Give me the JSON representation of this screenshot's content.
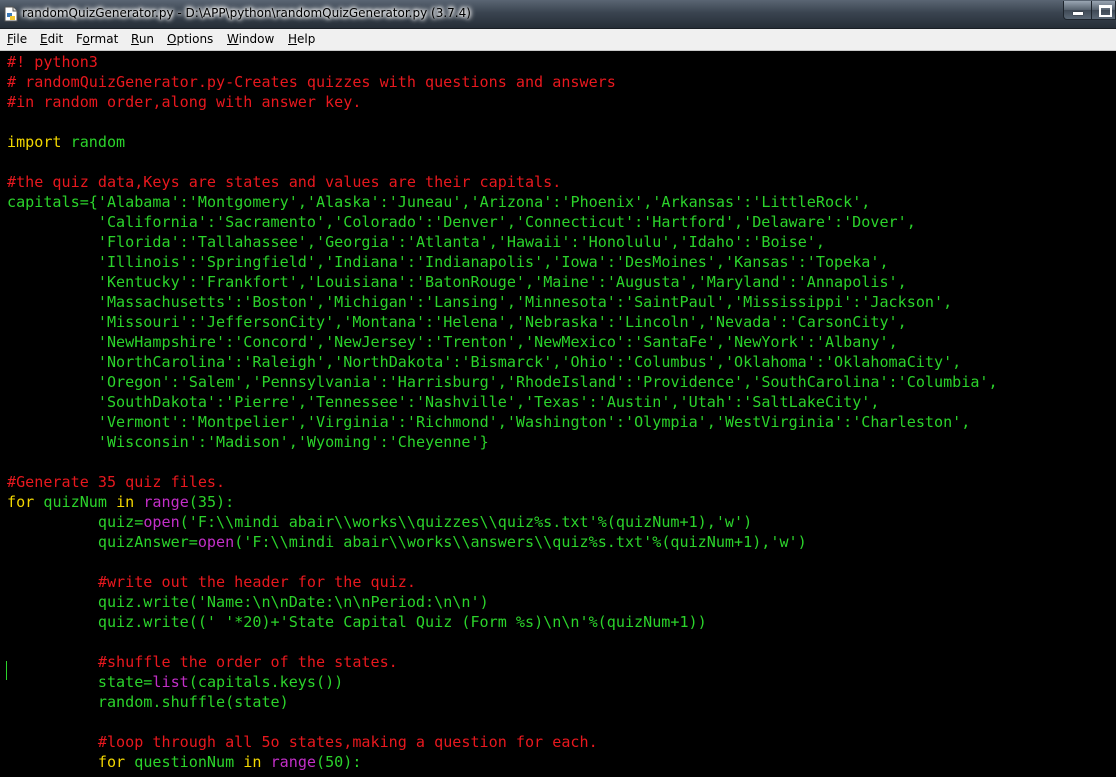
{
  "window": {
    "title": "randomQuizGenerator.py - D:\\APP\\python\\randomQuizGenerator.py (3.7.4)"
  },
  "menu": {
    "file": {
      "underline": "F",
      "rest": "ile"
    },
    "edit": {
      "underline": "E",
      "rest": "dit"
    },
    "format": {
      "pre": "F",
      "underline": "o",
      "rest": "rmat"
    },
    "run": {
      "underline": "R",
      "rest": "un"
    },
    "options": {
      "underline": "O",
      "rest": "ptions"
    },
    "window": {
      "underline": "W",
      "rest": "indow"
    },
    "help": {
      "underline": "H",
      "rest": "elp"
    }
  },
  "code_lines": [
    [
      [
        "c",
        "#! python3"
      ]
    ],
    [
      [
        "c",
        "# randomQuizGenerator.py-Creates quizzes with questions and answers"
      ]
    ],
    [
      [
        "c",
        "#in random order,along with answer key."
      ]
    ],
    [],
    [
      [
        "k",
        "import"
      ],
      [
        "n",
        " random"
      ]
    ],
    [],
    [
      [
        "c",
        "#the quiz data,Keys are states and values are their capitals."
      ]
    ],
    [
      [
        "n",
        "capitals={"
      ],
      [
        "s",
        "'Alabama'"
      ],
      [
        "n",
        ":"
      ],
      [
        "s",
        "'Montgomery'"
      ],
      [
        "n",
        ","
      ],
      [
        "s",
        "'Alaska'"
      ],
      [
        "n",
        ":"
      ],
      [
        "s",
        "'Juneau'"
      ],
      [
        "n",
        ","
      ],
      [
        "s",
        "'Arizona'"
      ],
      [
        "n",
        ":"
      ],
      [
        "s",
        "'Phoenix'"
      ],
      [
        "n",
        ","
      ],
      [
        "s",
        "'Arkansas'"
      ],
      [
        "n",
        ":"
      ],
      [
        "s",
        "'LittleRock'"
      ],
      [
        "n",
        ","
      ]
    ],
    [
      [
        "n",
        "          "
      ],
      [
        "s",
        "'California'"
      ],
      [
        "n",
        ":"
      ],
      [
        "s",
        "'Sacramento'"
      ],
      [
        "n",
        ","
      ],
      [
        "s",
        "'Colorado'"
      ],
      [
        "n",
        ":"
      ],
      [
        "s",
        "'Denver'"
      ],
      [
        "n",
        ","
      ],
      [
        "s",
        "'Connecticut'"
      ],
      [
        "n",
        ":"
      ],
      [
        "s",
        "'Hartford'"
      ],
      [
        "n",
        ","
      ],
      [
        "s",
        "'Delaware'"
      ],
      [
        "n",
        ":"
      ],
      [
        "s",
        "'Dover'"
      ],
      [
        "n",
        ","
      ]
    ],
    [
      [
        "n",
        "          "
      ],
      [
        "s",
        "'Florida'"
      ],
      [
        "n",
        ":"
      ],
      [
        "s",
        "'Tallahassee'"
      ],
      [
        "n",
        ","
      ],
      [
        "s",
        "'Georgia'"
      ],
      [
        "n",
        ":"
      ],
      [
        "s",
        "'Atlanta'"
      ],
      [
        "n",
        ","
      ],
      [
        "s",
        "'Hawaii'"
      ],
      [
        "n",
        ":"
      ],
      [
        "s",
        "'Honolulu'"
      ],
      [
        "n",
        ","
      ],
      [
        "s",
        "'Idaho'"
      ],
      [
        "n",
        ":"
      ],
      [
        "s",
        "'Boise'"
      ],
      [
        "n",
        ","
      ]
    ],
    [
      [
        "n",
        "          "
      ],
      [
        "s",
        "'Illinois'"
      ],
      [
        "n",
        ":"
      ],
      [
        "s",
        "'Springfield'"
      ],
      [
        "n",
        ","
      ],
      [
        "s",
        "'Indiana'"
      ],
      [
        "n",
        ":"
      ],
      [
        "s",
        "'Indianapolis'"
      ],
      [
        "n",
        ","
      ],
      [
        "s",
        "'Iowa'"
      ],
      [
        "n",
        ":"
      ],
      [
        "s",
        "'DesMoines'"
      ],
      [
        "n",
        ","
      ],
      [
        "s",
        "'Kansas'"
      ],
      [
        "n",
        ":"
      ],
      [
        "s",
        "'Topeka'"
      ],
      [
        "n",
        ","
      ]
    ],
    [
      [
        "n",
        "          "
      ],
      [
        "s",
        "'Kentucky'"
      ],
      [
        "n",
        ":"
      ],
      [
        "s",
        "'Frankfort'"
      ],
      [
        "n",
        ","
      ],
      [
        "s",
        "'Louisiana'"
      ],
      [
        "n",
        ":"
      ],
      [
        "s",
        "'BatonRouge'"
      ],
      [
        "n",
        ","
      ],
      [
        "s",
        "'Maine'"
      ],
      [
        "n",
        ":"
      ],
      [
        "s",
        "'Augusta'"
      ],
      [
        "n",
        ","
      ],
      [
        "s",
        "'Maryland'"
      ],
      [
        "n",
        ":"
      ],
      [
        "s",
        "'Annapolis'"
      ],
      [
        "n",
        ","
      ]
    ],
    [
      [
        "n",
        "          "
      ],
      [
        "s",
        "'Massachusetts'"
      ],
      [
        "n",
        ":"
      ],
      [
        "s",
        "'Boston'"
      ],
      [
        "n",
        ","
      ],
      [
        "s",
        "'Michigan'"
      ],
      [
        "n",
        ":"
      ],
      [
        "s",
        "'Lansing'"
      ],
      [
        "n",
        ","
      ],
      [
        "s",
        "'Minnesota'"
      ],
      [
        "n",
        ":"
      ],
      [
        "s",
        "'SaintPaul'"
      ],
      [
        "n",
        ","
      ],
      [
        "s",
        "'Mississippi'"
      ],
      [
        "n",
        ":"
      ],
      [
        "s",
        "'Jackson'"
      ],
      [
        "n",
        ","
      ]
    ],
    [
      [
        "n",
        "          "
      ],
      [
        "s",
        "'Missouri'"
      ],
      [
        "n",
        ":"
      ],
      [
        "s",
        "'JeffersonCity'"
      ],
      [
        "n",
        ","
      ],
      [
        "s",
        "'Montana'"
      ],
      [
        "n",
        ":"
      ],
      [
        "s",
        "'Helena'"
      ],
      [
        "n",
        ","
      ],
      [
        "s",
        "'Nebraska'"
      ],
      [
        "n",
        ":"
      ],
      [
        "s",
        "'Lincoln'"
      ],
      [
        "n",
        ","
      ],
      [
        "s",
        "'Nevada'"
      ],
      [
        "n",
        ":"
      ],
      [
        "s",
        "'CarsonCity'"
      ],
      [
        "n",
        ","
      ]
    ],
    [
      [
        "n",
        "          "
      ],
      [
        "s",
        "'NewHampshire'"
      ],
      [
        "n",
        ":"
      ],
      [
        "s",
        "'Concord'"
      ],
      [
        "n",
        ","
      ],
      [
        "s",
        "'NewJersey'"
      ],
      [
        "n",
        ":"
      ],
      [
        "s",
        "'Trenton'"
      ],
      [
        "n",
        ","
      ],
      [
        "s",
        "'NewMexico'"
      ],
      [
        "n",
        ":"
      ],
      [
        "s",
        "'SantaFe'"
      ],
      [
        "n",
        ","
      ],
      [
        "s",
        "'NewYork'"
      ],
      [
        "n",
        ":"
      ],
      [
        "s",
        "'Albany'"
      ],
      [
        "n",
        ","
      ]
    ],
    [
      [
        "n",
        "          "
      ],
      [
        "s",
        "'NorthCarolina'"
      ],
      [
        "n",
        ":"
      ],
      [
        "s",
        "'Raleigh'"
      ],
      [
        "n",
        ","
      ],
      [
        "s",
        "'NorthDakota'"
      ],
      [
        "n",
        ":"
      ],
      [
        "s",
        "'Bismarck'"
      ],
      [
        "n",
        ","
      ],
      [
        "s",
        "'Ohio'"
      ],
      [
        "n",
        ":"
      ],
      [
        "s",
        "'Columbus'"
      ],
      [
        "n",
        ","
      ],
      [
        "s",
        "'Oklahoma'"
      ],
      [
        "n",
        ":"
      ],
      [
        "s",
        "'OklahomaCity'"
      ],
      [
        "n",
        ","
      ]
    ],
    [
      [
        "n",
        "          "
      ],
      [
        "s",
        "'Oregon'"
      ],
      [
        "n",
        ":"
      ],
      [
        "s",
        "'Salem'"
      ],
      [
        "n",
        ","
      ],
      [
        "s",
        "'Pennsylvania'"
      ],
      [
        "n",
        ":"
      ],
      [
        "s",
        "'Harrisburg'"
      ],
      [
        "n",
        ","
      ],
      [
        "s",
        "'RhodeIsland'"
      ],
      [
        "n",
        ":"
      ],
      [
        "s",
        "'Providence'"
      ],
      [
        "n",
        ","
      ],
      [
        "s",
        "'SouthCarolina'"
      ],
      [
        "n",
        ":"
      ],
      [
        "s",
        "'Columbia'"
      ],
      [
        "n",
        ","
      ]
    ],
    [
      [
        "n",
        "          "
      ],
      [
        "s",
        "'SouthDakota'"
      ],
      [
        "n",
        ":"
      ],
      [
        "s",
        "'Pierre'"
      ],
      [
        "n",
        ","
      ],
      [
        "s",
        "'Tennessee'"
      ],
      [
        "n",
        ":"
      ],
      [
        "s",
        "'Nashville'"
      ],
      [
        "n",
        ","
      ],
      [
        "s",
        "'Texas'"
      ],
      [
        "n",
        ":"
      ],
      [
        "s",
        "'Austin'"
      ],
      [
        "n",
        ","
      ],
      [
        "s",
        "'Utah'"
      ],
      [
        "n",
        ":"
      ],
      [
        "s",
        "'SaltLakeCity'"
      ],
      [
        "n",
        ","
      ]
    ],
    [
      [
        "n",
        "          "
      ],
      [
        "s",
        "'Vermont'"
      ],
      [
        "n",
        ":"
      ],
      [
        "s",
        "'Montpelier'"
      ],
      [
        "n",
        ","
      ],
      [
        "s",
        "'Virginia'"
      ],
      [
        "n",
        ":"
      ],
      [
        "s",
        "'Richmond'"
      ],
      [
        "n",
        ","
      ],
      [
        "s",
        "'Washington'"
      ],
      [
        "n",
        ":"
      ],
      [
        "s",
        "'Olympia'"
      ],
      [
        "n",
        ","
      ],
      [
        "s",
        "'WestVirginia'"
      ],
      [
        "n",
        ":"
      ],
      [
        "s",
        "'Charleston'"
      ],
      [
        "n",
        ","
      ]
    ],
    [
      [
        "n",
        "          "
      ],
      [
        "s",
        "'Wisconsin'"
      ],
      [
        "n",
        ":"
      ],
      [
        "s",
        "'Madison'"
      ],
      [
        "n",
        ","
      ],
      [
        "s",
        "'Wyoming'"
      ],
      [
        "n",
        ":"
      ],
      [
        "s",
        "'Cheyenne'"
      ],
      [
        "n",
        "}"
      ]
    ],
    [],
    [
      [
        "c",
        "#Generate 35 quiz files."
      ]
    ],
    [
      [
        "k",
        "for"
      ],
      [
        "n",
        " quizNum "
      ],
      [
        "k",
        "in"
      ],
      [
        "n",
        " "
      ],
      [
        "b",
        "range"
      ],
      [
        "n",
        "(35):"
      ]
    ],
    [
      [
        "n",
        "          quiz="
      ],
      [
        "b",
        "open"
      ],
      [
        "n",
        "("
      ],
      [
        "s",
        "'F:\\\\mindi abair\\\\works\\\\quizzes\\\\quiz%s.txt'"
      ],
      [
        "n",
        "%(quizNum+1),"
      ],
      [
        "s",
        "'w'"
      ],
      [
        "n",
        ")"
      ]
    ],
    [
      [
        "n",
        "          quizAnswer="
      ],
      [
        "b",
        "open"
      ],
      [
        "n",
        "("
      ],
      [
        "s",
        "'F:\\\\mindi abair\\\\works\\\\answers\\\\quiz%s.txt'"
      ],
      [
        "n",
        "%(quizNum+1),"
      ],
      [
        "s",
        "'w'"
      ],
      [
        "n",
        ")"
      ]
    ],
    [],
    [
      [
        "n",
        "          "
      ],
      [
        "c",
        "#write out the header for the quiz."
      ]
    ],
    [
      [
        "n",
        "          quiz.write("
      ],
      [
        "s",
        "'Name:\\n\\nDate:\\n\\nPeriod:\\n\\n'"
      ],
      [
        "n",
        ")"
      ]
    ],
    [
      [
        "n",
        "          quiz.write(("
      ],
      [
        "s",
        "' '"
      ],
      [
        "n",
        "*20)+"
      ],
      [
        "s",
        "'State Capital Quiz (Form %s)\\n\\n'"
      ],
      [
        "n",
        "%(quizNum+1))"
      ]
    ],
    [],
    [
      [
        "n",
        "          "
      ],
      [
        "c",
        "#shuffle the order of the states."
      ]
    ],
    [
      [
        "n",
        "          state="
      ],
      [
        "b",
        "list"
      ],
      [
        "n",
        "(capitals.keys())"
      ]
    ],
    [
      [
        "n",
        "          random.shuffle(state)"
      ]
    ],
    [],
    [
      [
        "n",
        "          "
      ],
      [
        "c",
        "#loop through all 5o states,making a question for each."
      ]
    ],
    [
      [
        "n",
        "          "
      ],
      [
        "k",
        "for"
      ],
      [
        "n",
        " questionNum "
      ],
      [
        "k",
        "in"
      ],
      [
        "n",
        " "
      ],
      [
        "b",
        "range"
      ],
      [
        "n",
        "(50):"
      ]
    ]
  ]
}
